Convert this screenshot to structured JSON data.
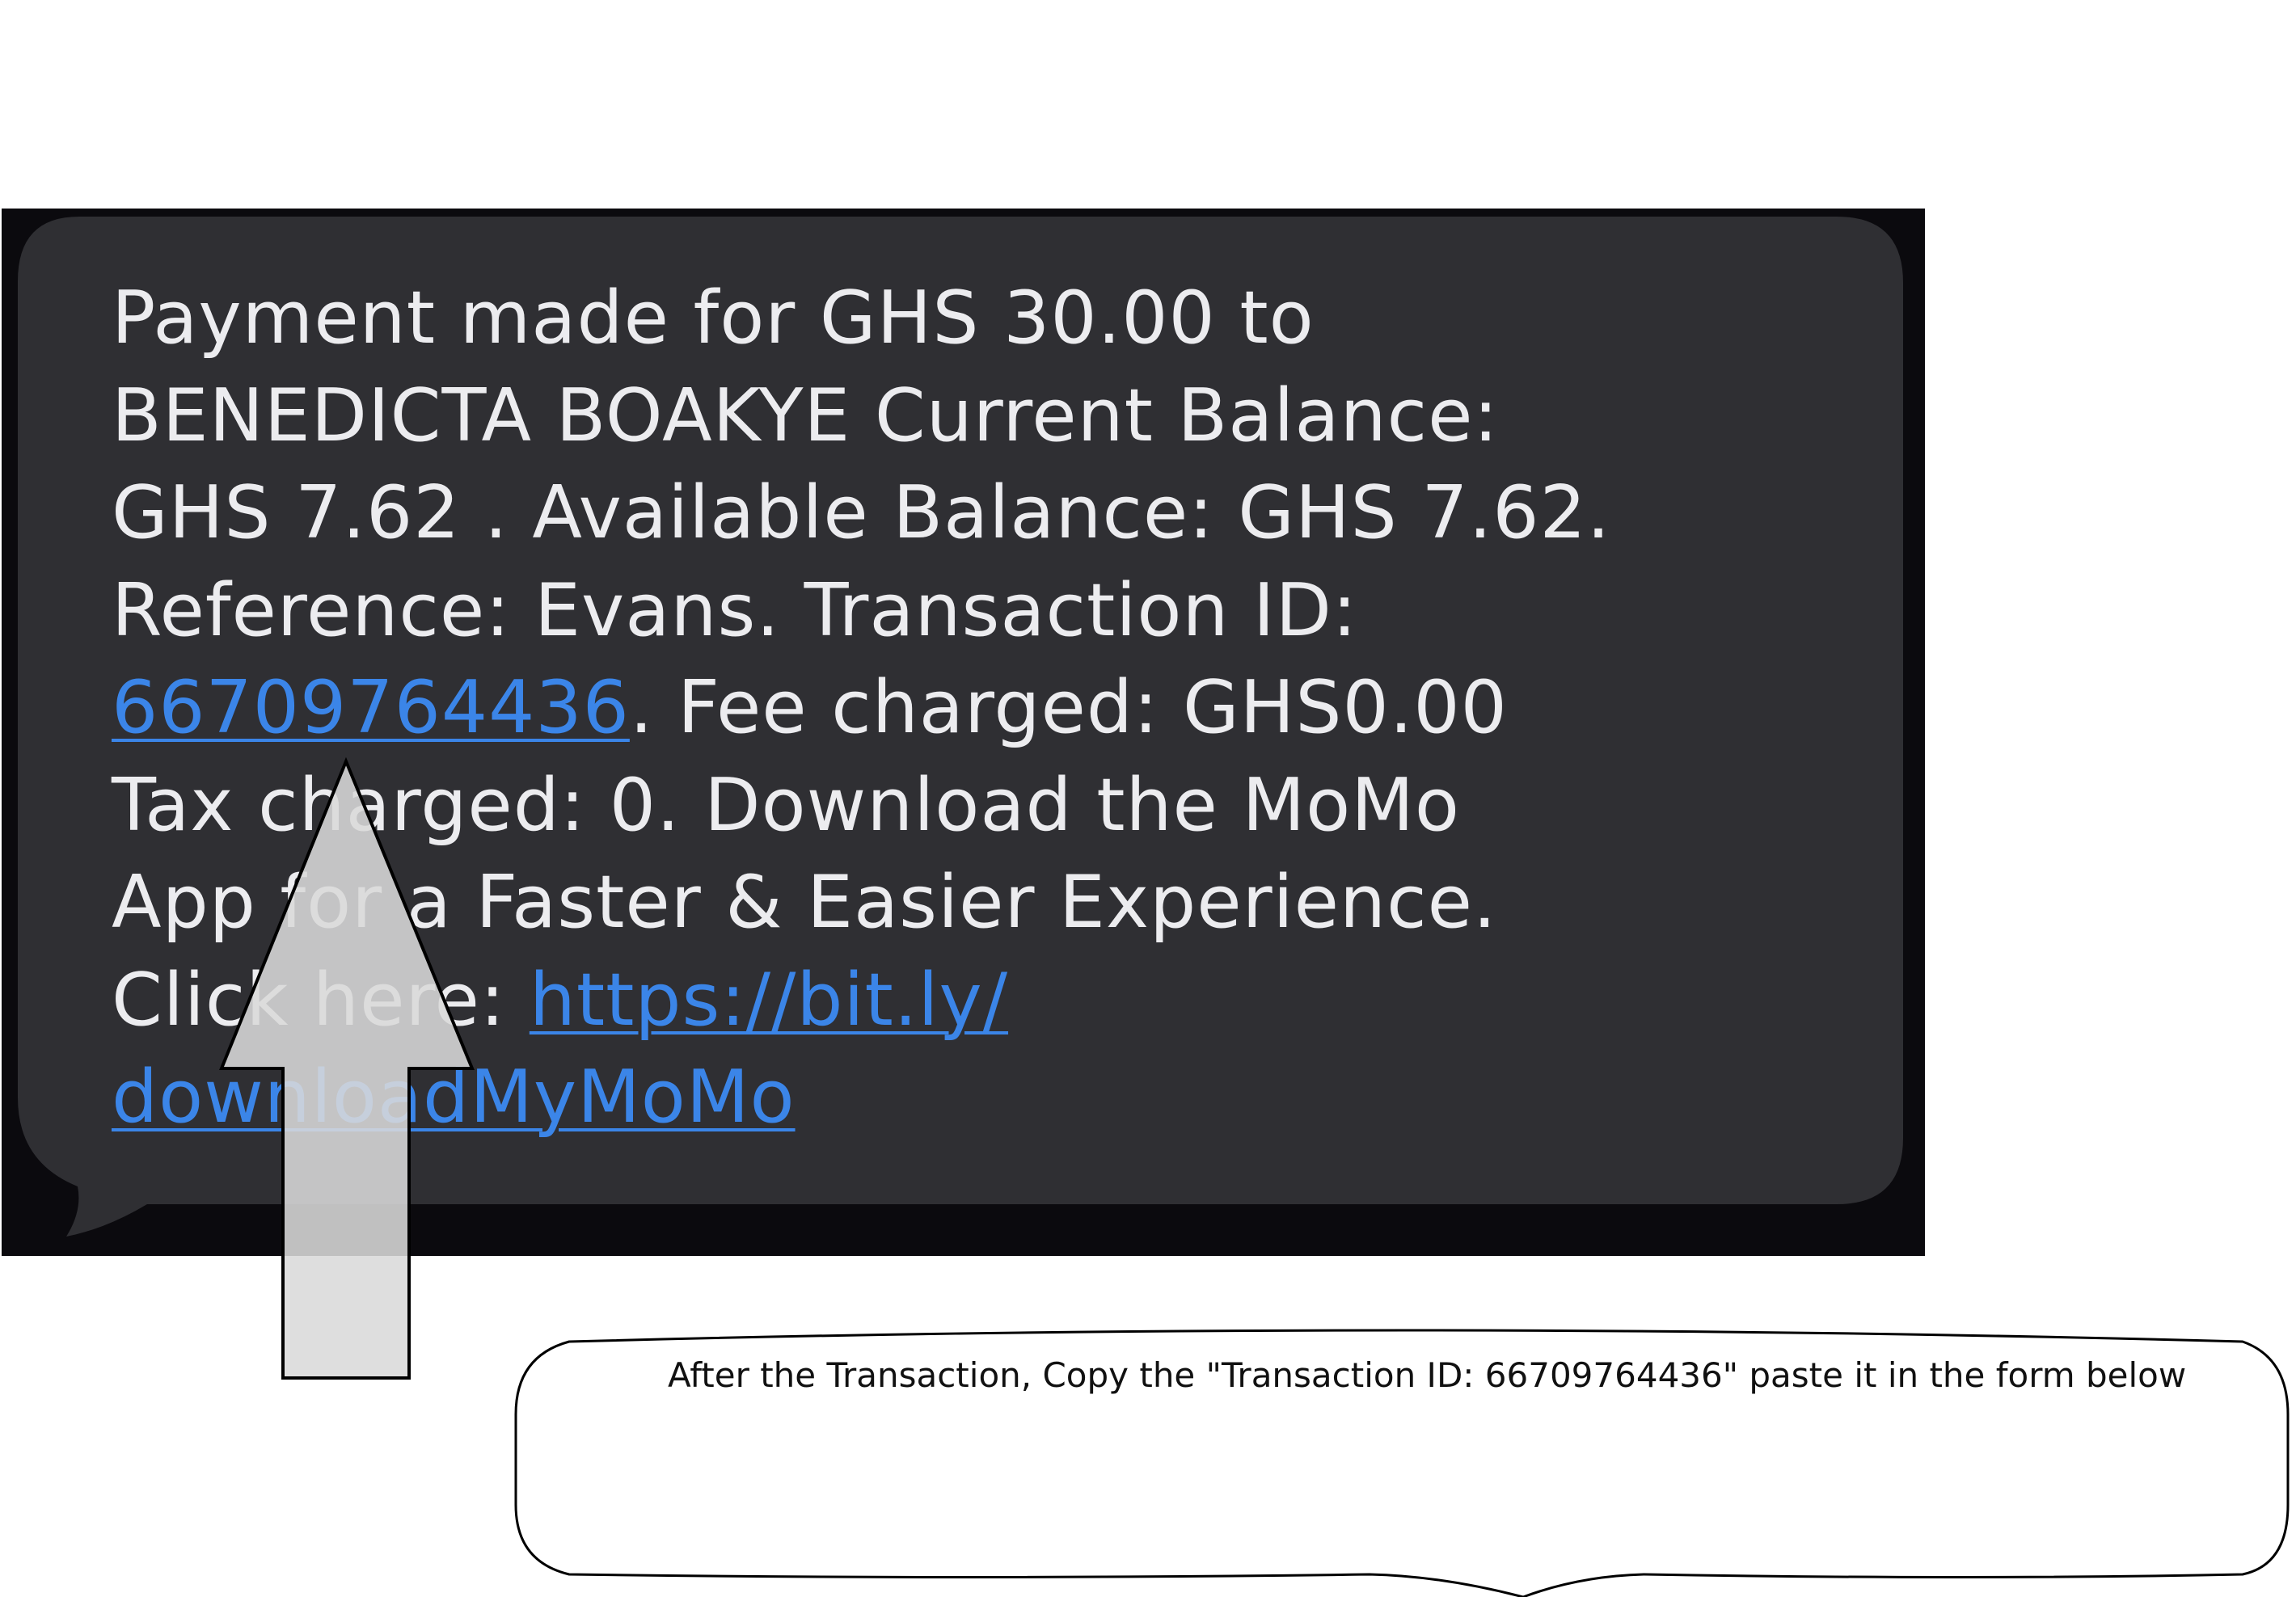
{
  "message": {
    "line1": "Payment made for GHS 30.00 to",
    "line2": "BENEDICTA BOAKYE Current Balance:",
    "line3": "GHS 7.62 . Available Balance: GHS 7.62.",
    "line4": "Reference: Evans. Transaction ID:",
    "transaction_id_link": "66709764436",
    "line5_rest": ". Fee charged: GHS0.00",
    "line6": "Tax charged: 0. Download the MoMo",
    "line7": "App for a Faster & Easier Experience.",
    "line8_prefix": "Click here: ",
    "download_link_part1": "https://bit.ly/",
    "download_link_part2": "downloadMyMoMo"
  },
  "callout": {
    "text": "After the Transaction, Copy the \"Transaction ID: 66709764436\" paste it in the form below"
  },
  "colors": {
    "backdrop": "#0b0a0e",
    "bubble": "#2f2f33",
    "message_text": "#ececef",
    "link": "#3b85e8",
    "arrow_fill": "#d9d9d9"
  }
}
